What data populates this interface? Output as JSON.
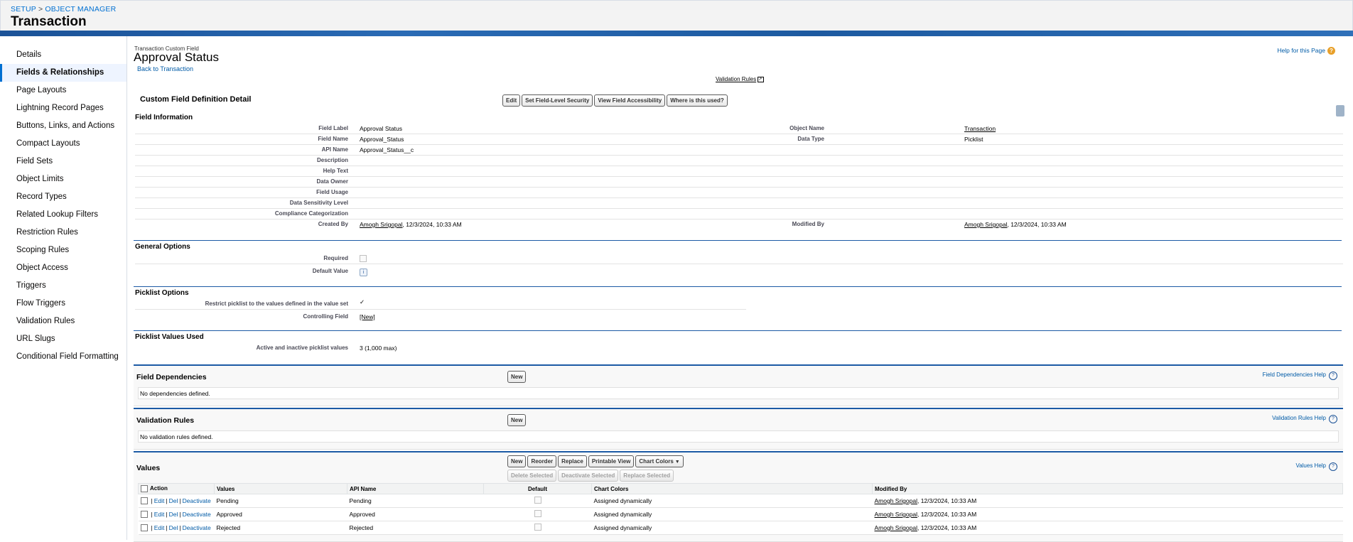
{
  "breadcrumb": {
    "setup": "SETUP",
    "separator": ">",
    "object_manager": "OBJECT MANAGER"
  },
  "object_title": "Transaction",
  "sidebar": {
    "items": [
      {
        "label": "Details",
        "active": false
      },
      {
        "label": "Fields & Relationships",
        "active": true
      },
      {
        "label": "Page Layouts",
        "active": false
      },
      {
        "label": "Lightning Record Pages",
        "active": false
      },
      {
        "label": "Buttons, Links, and Actions",
        "active": false
      },
      {
        "label": "Compact Layouts",
        "active": false
      },
      {
        "label": "Field Sets",
        "active": false
      },
      {
        "label": "Object Limits",
        "active": false
      },
      {
        "label": "Record Types",
        "active": false
      },
      {
        "label": "Related Lookup Filters",
        "active": false
      },
      {
        "label": "Restriction Rules",
        "active": false
      },
      {
        "label": "Scoping Rules",
        "active": false
      },
      {
        "label": "Object Access",
        "active": false
      },
      {
        "label": "Triggers",
        "active": false
      },
      {
        "label": "Flow Triggers",
        "active": false
      },
      {
        "label": "Validation Rules",
        "active": false
      },
      {
        "label": "URL Slugs",
        "active": false
      },
      {
        "label": "Conditional Field Formatting",
        "active": false
      }
    ]
  },
  "page": {
    "type_label": "Transaction Custom Field",
    "title": "Approval Status",
    "back_link": "Back to Transaction",
    "help_link": "Help for this Page",
    "help_icon": "?",
    "validation_rules_link": "Validation Rules",
    "external_icon": "↗"
  },
  "detail": {
    "header": "Custom Field Definition Detail",
    "buttons": {
      "edit": "Edit",
      "fls": "Set Field-Level Security",
      "accessibility": "View Field Accessibility",
      "where_used": "Where is this used?"
    }
  },
  "field_info": {
    "title": "Field Information",
    "field_label": {
      "label": "Field Label",
      "value": "Approval Status"
    },
    "field_name": {
      "label": "Field Name",
      "value": "Approval_Status"
    },
    "api_name": {
      "label": "API Name",
      "value": "Approval_Status__c"
    },
    "description": {
      "label": "Description"
    },
    "help_text": {
      "label": "Help Text"
    },
    "data_owner": {
      "label": "Data Owner"
    },
    "field_usage": {
      "label": "Field Usage"
    },
    "data_sensitivity": {
      "label": "Data Sensitivity Level"
    },
    "compliance": {
      "label": "Compliance Categorization"
    },
    "created_by": {
      "label": "Created By",
      "user": "Amogh Srigopal",
      "date": ", 12/3/2024, 10:33 AM"
    },
    "object_name": {
      "label": "Object Name",
      "value": "Transaction"
    },
    "data_type": {
      "label": "Data Type",
      "value": "Picklist"
    },
    "modified_by": {
      "label": "Modified By",
      "user": "Amogh Srigopal",
      "date": ", 12/3/2024, 10:33 AM"
    }
  },
  "general_options": {
    "title": "General Options",
    "required": {
      "label": "Required"
    },
    "default_value": {
      "label": "Default Value",
      "icon": "i"
    }
  },
  "picklist_options": {
    "title": "Picklist Options",
    "restrict": {
      "label": "Restrict picklist to the values defined in the value set",
      "check": "✓"
    },
    "controlling": {
      "label": "Controlling Field",
      "value": "[New]"
    }
  },
  "picklist_used": {
    "title": "Picklist Values Used",
    "active_inactive": {
      "label": "Active and inactive picklist values",
      "value": "3 (1,000 max)"
    }
  },
  "dependencies": {
    "title": "Field Dependencies",
    "new_button": "New",
    "help": "Field Dependencies Help",
    "help_icon": "?",
    "empty": "No dependencies defined."
  },
  "validation": {
    "title": "Validation Rules",
    "new_button": "New",
    "help": "Validation Rules Help",
    "help_icon": "?",
    "empty": "No validation rules defined."
  },
  "values": {
    "title": "Values",
    "help": "Values Help",
    "help_icon": "?",
    "buttons": {
      "new": "New",
      "reorder": "Reorder",
      "replace": "Replace",
      "printable": "Printable View",
      "chart_colors": "Chart Colors",
      "delete_selected": "Delete Selected",
      "deactivate_selected": "Deactivate Selected",
      "replace_selected": "Replace Selected"
    },
    "columns": {
      "action": "Action",
      "values": "Values",
      "api_name": "API Name",
      "default": "Default",
      "chart_colors": "Chart Colors",
      "modified_by": "Modified By"
    },
    "action_links": {
      "edit": "Edit",
      "del": "Del",
      "deactivate": "Deactivate",
      "pipe": "|"
    },
    "rows": [
      {
        "value": "Pending",
        "api": "Pending",
        "chart": "Assigned dynamically",
        "user": "Amogh Srigopal",
        "date": ", 12/3/2024, 10:33 AM"
      },
      {
        "value": "Approved",
        "api": "Approved",
        "chart": "Assigned dynamically",
        "user": "Amogh Srigopal",
        "date": ", 12/3/2024, 10:33 AM"
      },
      {
        "value": "Rejected",
        "api": "Rejected",
        "chart": "Assigned dynamically",
        "user": "Amogh Srigopal",
        "date": ", 12/3/2024, 10:33 AM"
      }
    ]
  }
}
